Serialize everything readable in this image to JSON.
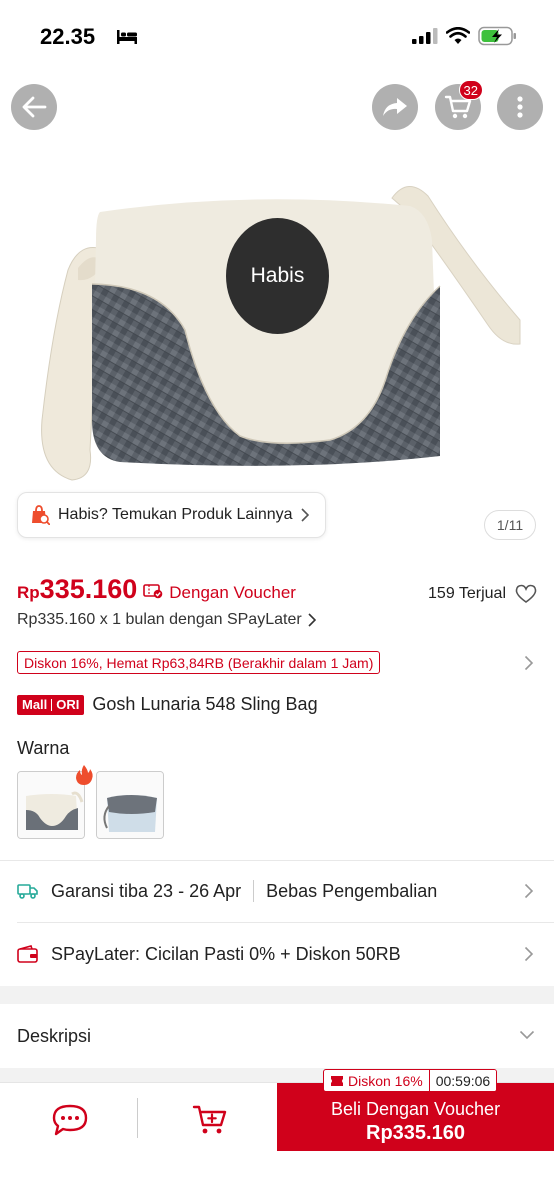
{
  "status_bar": {
    "time": "22.35"
  },
  "header": {
    "cart_count": "32"
  },
  "gallery": {
    "soldout_label": "Habis",
    "find_other_label": "Habis? Temukan Produk Lainnya",
    "page_indicator": "1/11"
  },
  "price": {
    "currency": "Rp",
    "amount": "335.160",
    "voucher_label": "Dengan Voucher",
    "sold_label": "159 Terjual",
    "paylater_label": "Rp335.160 x 1 bulan dengan SPayLater"
  },
  "discount": {
    "label": "Diskon 16%, Hemat Rp63,84RB (Berakhir dalam 1 Jam)"
  },
  "product": {
    "badge_mall": "Mall",
    "badge_ori": "ORI",
    "title": "Gosh Lunaria 548 Sling Bag"
  },
  "variants": {
    "label": "Warna"
  },
  "shipping": {
    "guarantee_label": "Garansi tiba 23 - 26 Apr",
    "return_label": "Bebas Pengembalian"
  },
  "paylater_promo": {
    "label": "SPayLater: Cicilan Pasti 0% + Diskon 50RB"
  },
  "description": {
    "label": "Deskripsi"
  },
  "bottom_bar": {
    "promo_discount": "Diskon 16%",
    "promo_timer": "00:59:06",
    "buy_label": "Beli Dengan Voucher",
    "buy_price": "Rp335.160"
  },
  "colors": {
    "accent": "#d0011b",
    "soldout_overlay": "#2e2e2e",
    "bag_cream": "#efebe0",
    "bag_grey": "#5a6068"
  },
  "icons": [
    "bed-icon",
    "signal-icon",
    "wifi-icon",
    "battery-icon",
    "back-arrow-icon",
    "share-icon",
    "cart-icon",
    "more-icon",
    "shopping-bag-icon",
    "voucher-icon",
    "heart-icon",
    "fire-icon",
    "truck-icon",
    "wallet-icon",
    "chat-icon",
    "add-to-cart-icon"
  ]
}
